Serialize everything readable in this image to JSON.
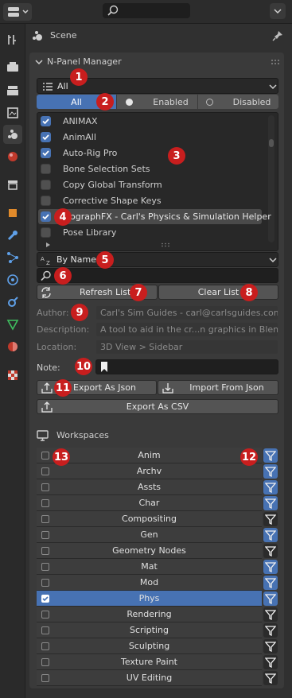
{
  "header": {
    "panel_title": "Scene"
  },
  "npanel": {
    "title": "N-Panel Manager",
    "category_dropdown": "All",
    "filter_tabs": [
      "All",
      "Enabled",
      "Disabled"
    ],
    "addons": [
      {
        "label": "ANIMAX",
        "checked": true
      },
      {
        "label": "AnimAll",
        "checked": true
      },
      {
        "label": "Auto-Rig Pro",
        "checked": true
      },
      {
        "label": "Bone Selection Sets",
        "checked": false
      },
      {
        "label": "Copy Global Transform",
        "checked": false
      },
      {
        "label": "Corrective Shape Keys",
        "checked": false
      },
      {
        "label": "ographFX - Carl's Physics & Simulation Helper",
        "checked": true
      },
      {
        "label": "Pose Library",
        "checked": false
      }
    ],
    "sort_dropdown": "By Name",
    "search_value": "",
    "refresh_label": "Refresh List",
    "clear_label": "Clear List",
    "author_label": "Author:",
    "author_value": "Carl's Sim Guides - carl@carlsguides.com",
    "description_label": "Description:",
    "description_value": "A tool to aid in the cr...n graphics in Blender.",
    "location_label": "Location:",
    "location_value": "3D View > Sidebar",
    "note_label": "Note:",
    "note_value": "",
    "export_json_label": "Export As Json",
    "import_json_label": "Import From Json",
    "export_csv_label": "Export As CSV"
  },
  "workspaces": {
    "title": "Workspaces",
    "items": [
      {
        "label": "Anim",
        "checked": false,
        "filter_on": true
      },
      {
        "label": "Archv",
        "checked": false,
        "filter_on": true
      },
      {
        "label": "Assts",
        "checked": false,
        "filter_on": true
      },
      {
        "label": "Char",
        "checked": false,
        "filter_on": true
      },
      {
        "label": "Compositing",
        "checked": false,
        "filter_on": false
      },
      {
        "label": "Gen",
        "checked": false,
        "filter_on": true
      },
      {
        "label": "Geometry Nodes",
        "checked": false,
        "filter_on": false
      },
      {
        "label": "Mat",
        "checked": false,
        "filter_on": true
      },
      {
        "label": "Mod",
        "checked": false,
        "filter_on": true
      },
      {
        "label": "Phys",
        "checked": true,
        "filter_on": true
      },
      {
        "label": "Rendering",
        "checked": false,
        "filter_on": false
      },
      {
        "label": "Scripting",
        "checked": false,
        "filter_on": false
      },
      {
        "label": "Sculpting",
        "checked": false,
        "filter_on": false
      },
      {
        "label": "Texture Paint",
        "checked": false,
        "filter_on": false
      },
      {
        "label": "UV Editing",
        "checked": false,
        "filter_on": false
      }
    ]
  },
  "badges": [
    "1",
    "2",
    "3",
    "4",
    "5",
    "6",
    "7",
    "8",
    "9",
    "10",
    "11",
    "12",
    "13"
  ],
  "colors": {
    "accent": "#4772b3",
    "badge": "#c81e1e",
    "bg": "#303030"
  }
}
